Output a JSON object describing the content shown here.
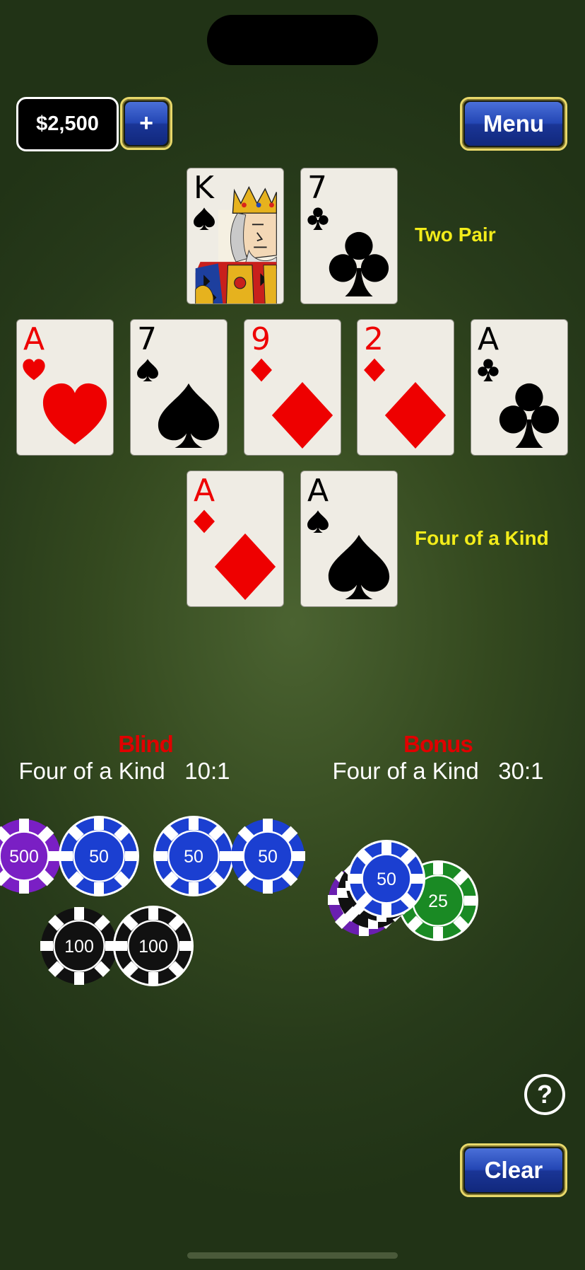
{
  "balance": "$2,500",
  "add_label": "+",
  "menu_label": "Menu",
  "clear_label": "Clear",
  "help_label": "?",
  "dealer_hand": {
    "label": "Two Pair",
    "cards": [
      {
        "rank": "K",
        "suit": "spade",
        "color": "black",
        "face": true
      },
      {
        "rank": "7",
        "suit": "club",
        "color": "black"
      }
    ]
  },
  "community": [
    {
      "rank": "A",
      "suit": "heart",
      "color": "red"
    },
    {
      "rank": "7",
      "suit": "spade",
      "color": "black"
    },
    {
      "rank": "9",
      "suit": "diamond",
      "color": "red"
    },
    {
      "rank": "2",
      "suit": "diamond",
      "color": "red"
    },
    {
      "rank": "A",
      "suit": "club",
      "color": "black"
    }
  ],
  "player_hand": {
    "label": "Four of a Kind",
    "cards": [
      {
        "rank": "A",
        "suit": "diamond",
        "color": "red"
      },
      {
        "rank": "A",
        "suit": "spade",
        "color": "black"
      }
    ]
  },
  "blind": {
    "title": "Blind",
    "hand": "Four of a Kind",
    "odds": "10:1"
  },
  "bonus": {
    "title": "Bonus",
    "hand": "Four of a Kind",
    "odds": "30:1"
  },
  "chips": {
    "c500": "500",
    "c50a": "50",
    "c50b": "50",
    "c50c": "50",
    "c100a": "100",
    "c100b": "100",
    "bonus50": "50",
    "bonus25": "25"
  },
  "colors": {
    "gold_text": "#f2ec1a",
    "bet_title": "#e00000",
    "felt": "#34491f"
  }
}
